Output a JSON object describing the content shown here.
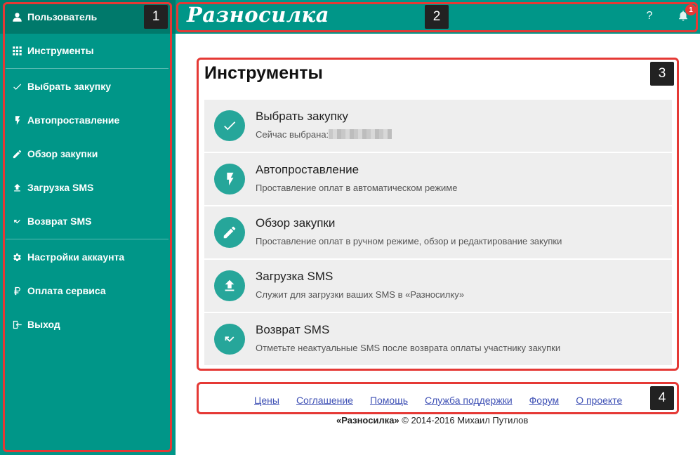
{
  "sidebar": {
    "items": [
      {
        "label": "Пользователь",
        "icon": "user-icon"
      },
      {
        "label": "Инструменты",
        "icon": "apps-grid-icon"
      },
      {
        "label": "Выбрать закупку",
        "icon": "check-icon"
      },
      {
        "label": "Автопроставление",
        "icon": "lightning-icon"
      },
      {
        "label": "Обзор закупки",
        "icon": "pencil-icon"
      },
      {
        "label": "Загрузка SMS",
        "icon": "upload-icon"
      },
      {
        "label": "Возврат SMS",
        "icon": "return-arrow-icon"
      },
      {
        "label": "Настройки аккаунта",
        "icon": "gear-icon"
      },
      {
        "label": "Оплата сервиса",
        "icon": "ruble-icon"
      },
      {
        "label": "Выход",
        "icon": "logout-icon"
      }
    ]
  },
  "header": {
    "brand": "Разносилка",
    "help_label": "?",
    "notification_count": "1"
  },
  "main": {
    "title": "Инструменты",
    "tools": [
      {
        "title": "Выбрать закупку",
        "subtitle": "Сейчас выбрана:",
        "icon": "check-icon"
      },
      {
        "title": "Автопроставление",
        "subtitle": "Проставление оплат в автоматическом режиме",
        "icon": "lightning-icon"
      },
      {
        "title": "Обзор закупки",
        "subtitle": "Проставление оплат в ручном режиме, обзор и редактирование закупки",
        "icon": "pencil-icon"
      },
      {
        "title": "Загрузка SMS",
        "subtitle": "Служит для загрузки ваших SMS в «Разносилку»",
        "icon": "upload-icon"
      },
      {
        "title": "Возврат SMS",
        "subtitle": "Отметьте неактуальные SMS после возврата оплаты участнику закупки",
        "icon": "return-arrow-icon"
      }
    ]
  },
  "footer": {
    "links": [
      "Цены",
      "Соглашение",
      "Помощь",
      "Служба поддержки",
      "Форум",
      "О проекте"
    ],
    "copyright_brand": "«Разносилка»",
    "copyright_rest": "© 2014-2016 Михаил Путилов"
  },
  "annotations": [
    "1",
    "2",
    "3",
    "4"
  ],
  "colors": {
    "primary": "#009688",
    "primary_dark": "#00796b",
    "accent_circle": "#26a69a",
    "annotation_red": "#e53935",
    "link": "#3f51b5"
  }
}
